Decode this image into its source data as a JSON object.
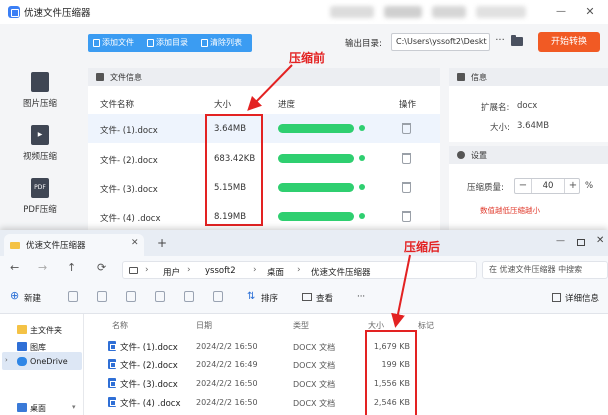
{
  "app": {
    "title": "优速文件压缩器",
    "win_min": "—",
    "win_close": "✕",
    "sidebar": [
      {
        "label": "图片压缩",
        "icon": "image-file-icon",
        "glyph": ""
      },
      {
        "label": "视频压缩",
        "icon": "video-file-icon",
        "glyph": "▶"
      },
      {
        "label": "PDF压缩",
        "icon": "pdf-file-icon",
        "glyph": "PDF"
      }
    ],
    "toolbar": {
      "add_file": "添加文件",
      "add_dir": "添加目录",
      "clear_list": "清除列表",
      "output_label": "输出目录:",
      "output_value": "C:\\Users\\yssoft2\\Deskt",
      "more": "···",
      "start": "开始转换"
    },
    "file_panel": {
      "title": "文件信息",
      "columns": {
        "name": "文件名称",
        "size": "大小",
        "progress": "进度",
        "action": "操作"
      },
      "rows": [
        {
          "name": "文件- (1).docx",
          "size": "3.64MB",
          "progress": 1.0
        },
        {
          "name": "文件- (2).docx",
          "size": "683.42KB",
          "progress": 1.0
        },
        {
          "name": "文件- (3).docx",
          "size": "5.15MB",
          "progress": 1.0
        },
        {
          "name": "文件- (4) .docx",
          "size": "8.19MB",
          "progress": 1.0
        }
      ]
    },
    "info_panel": {
      "title": "信息",
      "ext_label": "扩展名:",
      "ext_value": "docx",
      "size_label": "大小:",
      "size_value": "3.64MB"
    },
    "settings_panel": {
      "title": "设置",
      "quality_label": "压缩质量:",
      "minus": "−",
      "quality_value": "40",
      "plus": "+",
      "unit": "%",
      "hint": "数值越低压缩越小"
    }
  },
  "annotations": {
    "before": "压缩前",
    "after": "压缩后",
    "color": "#e32222"
  },
  "explorer": {
    "tab_title": "优速文件压缩器",
    "tab_close": "✕",
    "new_tab": "+",
    "win_min": "—",
    "win_close": "✕",
    "nav": {
      "back": "←",
      "forward": "→",
      "up": "↑",
      "refresh": "⟳"
    },
    "breadcrumb": [
      "用户",
      "yssoft2",
      "桌面",
      "优速文件压缩器"
    ],
    "search_placeholder": "在 优速文件压缩器 中搜索",
    "commands": {
      "new": "新建",
      "sort": "排序",
      "view": "查看",
      "more": "···",
      "details": "详细信息"
    },
    "nav_pane": [
      {
        "label": "主文件夹",
        "icon": "home-icon"
      },
      {
        "label": "图库",
        "icon": "gallery-icon"
      },
      {
        "label": "OneDrive",
        "icon": "cloud-icon"
      },
      {
        "label": "桌面",
        "icon": "desktop-icon"
      }
    ],
    "columns": {
      "name": "名称",
      "date": "日期",
      "type": "类型",
      "size": "大小",
      "tag": "标记"
    },
    "files": [
      {
        "name": "文件- (1).docx",
        "date": "2024/2/2 16:50",
        "type": "DOCX 文档",
        "size": "1,679 KB"
      },
      {
        "name": "文件- (2).docx",
        "date": "2024/2/2 16:49",
        "type": "DOCX 文档",
        "size": "199 KB"
      },
      {
        "name": "文件- (3).docx",
        "date": "2024/2/2 16:50",
        "type": "DOCX 文档",
        "size": "1,556 KB"
      },
      {
        "name": "文件- (4) .docx",
        "date": "2024/2/2 16:50",
        "type": "DOCX 文档",
        "size": "2,546 KB"
      }
    ]
  },
  "colors": {
    "primary": "#3b9cf2",
    "accent": "#f15a24",
    "progress": "#2fcf70",
    "annotation": "#e32222"
  }
}
